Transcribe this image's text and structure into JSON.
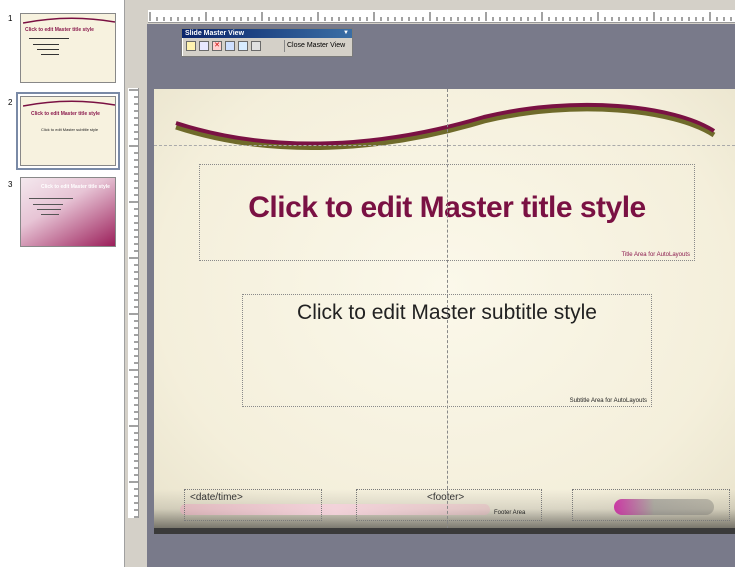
{
  "thumbnails": [
    {
      "number": "1",
      "title": "Click to edit Master title style"
    },
    {
      "number": "2",
      "title": "Click to edit Master title style",
      "subtitle": "Click to edit Master subtitle style"
    },
    {
      "number": "3",
      "title": "Click to edit Master title style"
    }
  ],
  "toolbar": {
    "title": "Slide Master View",
    "close_label": "Close Master View"
  },
  "slide": {
    "title": "Click to edit Master title style",
    "title_area_label": "Title Area for AutoLayouts",
    "subtitle": "Click to edit Master subtitle style",
    "subtitle_area_label": "Subtitle Area for AutoLayouts",
    "date_label": "<date/time>",
    "footer_label": "<footer>",
    "footer_area_label": "Footer Area"
  },
  "colors": {
    "title": "#7a1143",
    "swoosh_top": "#7a1143",
    "swoosh_bottom": "#6f6a2a",
    "workspace": "#797a8a"
  }
}
